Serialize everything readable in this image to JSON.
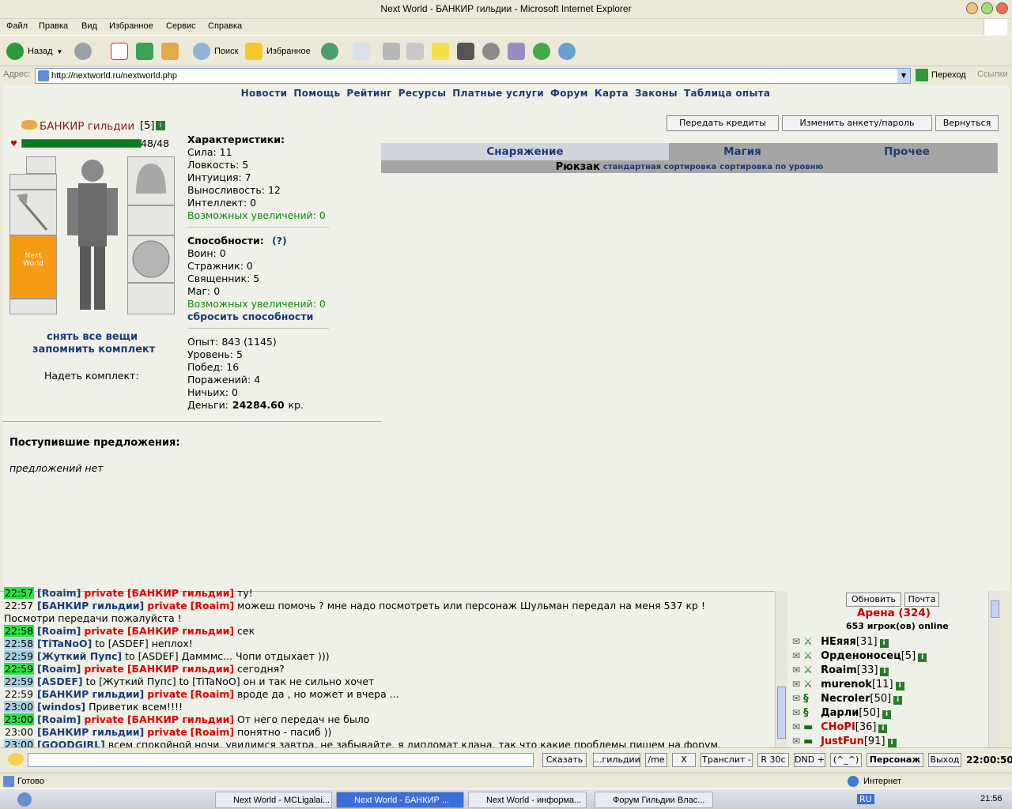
{
  "window": {
    "title": "Next World - БАНКИР гильдии - Microsoft Internet Explorer"
  },
  "menu": [
    "Файл",
    "Правка",
    "Вид",
    "Избранное",
    "Сервис",
    "Справка"
  ],
  "toolbar": {
    "back": "Назад",
    "search": "Поиск",
    "favorites": "Избранное"
  },
  "address": {
    "label": "Адрес:",
    "url": "http://nextworld.ru/nextworld.php",
    "go": "Переход",
    "links": "Ссылки"
  },
  "nav": [
    "Новости",
    "Помощь",
    "Рейтинг",
    "Ресурсы",
    "Платные услуги",
    "Форум",
    "Карта",
    "Законы",
    "Таблица опыта"
  ],
  "char": {
    "name": "БАНКИР гильдии",
    "level": "[5]",
    "hp": "48/48",
    "hp_fraction": 1.0,
    "shirt_text": "Next World"
  },
  "char_links": {
    "unequip": "снять все вещи",
    "remember": "запомнить комплект",
    "wear": "Надеть комплект:"
  },
  "stats": {
    "header": "Характеристики:",
    "lines": [
      "Сила: 11",
      "Ловкость: 5",
      "Интуиция: 7",
      "Выносливость: 12",
      "Интеллект: 0"
    ],
    "increases": "Возможных увеличений: 0"
  },
  "abilities": {
    "header": "Способности:",
    "help": "(?)",
    "lines": [
      "Воин: 0",
      "Стражник: 0",
      "Священник: 5",
      "Маг: 0"
    ],
    "increases": "Возможных увеличений: 0",
    "reset": "сбросить способности"
  },
  "progress": {
    "lines": [
      "Опыт: 843 (1145)",
      "Уровень: 5",
      "Побед: 16",
      "Поражений: 4",
      "Ничьих: 0"
    ],
    "money_label": "Деньги:",
    "money_value": "24284.60",
    "money_unit": "кр."
  },
  "offers": {
    "title": "Поступившие предложения:",
    "empty": "предложений нет"
  },
  "actions": {
    "transfer": "Передать кредиты",
    "edit": "Изменить анкету/пароль",
    "back": "Вернуться"
  },
  "inv_tabs": [
    "Снаряжение",
    "Магия",
    "Прочее"
  ],
  "backpack": {
    "label": "Рюкзак",
    "sort_std": "стандартная сортировка",
    "sort_lvl": "сортировка по уровню"
  },
  "chat": {
    "lines": [
      {
        "ts": "22:57",
        "tsStyle": "g",
        "n1": "[Roaim]",
        "priv": "private",
        "n2": "[БАНКИР гильдии]",
        "text": " ту!"
      },
      {
        "ts": "22:57",
        "tsStyle": "",
        "n1": "[БАНКИР гильдии]",
        "priv": "private",
        "n2": "[Roaim]",
        "text": " можеш помочь ? мне надо посмотреть или персонаж Шульман передал на меня 537 кр !"
      },
      {
        "ts": "",
        "tsStyle": "",
        "n1": "",
        "priv": "",
        "n2": "",
        "text": "Посмотри передачи пожалуйста !"
      },
      {
        "ts": "22:58",
        "tsStyle": "g",
        "n1": "[Roaim]",
        "priv": "private",
        "n2": "[БАНКИР гильдии]",
        "text": " сек"
      },
      {
        "ts": "22:58",
        "tsStyle": "b",
        "n1": "[TiTaNoO]",
        "priv": "",
        "n2": "",
        "text": " to [ASDEF] неплох!"
      },
      {
        "ts": "22:59",
        "tsStyle": "b",
        "n1": "[Жуткий Пупс]",
        "priv": "",
        "n2": "",
        "text": " to [ASDEF] Дамммс... Чопи отдыхает )))"
      },
      {
        "ts": "22:59",
        "tsStyle": "g",
        "n1": "[Roaim]",
        "priv": "private",
        "n2": "[БАНКИР гильдии]",
        "text": " сегодня?"
      },
      {
        "ts": "22:59",
        "tsStyle": "b",
        "n1": "[ASDEF]",
        "priv": "",
        "n2": "",
        "text": " to [Жуткий Пупс] to [TiTaNoO] он и так не сильно хочет"
      },
      {
        "ts": "22:59",
        "tsStyle": "",
        "n1": "[БАНКИР гильдии]",
        "priv": "private",
        "n2": "[Roaim]",
        "text": " вроде да , но может и вчера ..."
      },
      {
        "ts": "23:00",
        "tsStyle": "b",
        "n1": "[windos]",
        "priv": "",
        "n2": "",
        "text": " Приветик всем!!!!"
      },
      {
        "ts": "23:00",
        "tsStyle": "g",
        "n1": "[Roaim]",
        "priv": "private",
        "n2": "[БАНКИР гильдии]",
        "text": " От него передач не было"
      },
      {
        "ts": "23:00",
        "tsStyle": "",
        "n1": "[БАНКИР гильдии]",
        "priv": "private",
        "n2": "[Roaim]",
        "text": " понятно - пасиб ))"
      },
      {
        "ts": "23:00",
        "tsStyle": "b",
        "n1": "[GOODGIRL]",
        "priv": "",
        "n2": "",
        "text": " всем спокойной ночи, увидимся завтра, не забывайте, я дипломат клана, так что какие проблемы пишем на форум,"
      }
    ]
  },
  "users": {
    "refresh": "Обновить",
    "mail": "Почта",
    "arena": "Арена (324)",
    "online": "653 игрок(ов) online",
    "list": [
      {
        "name": "НЕяяя",
        "lvl": "[31]",
        "color": "#000000",
        "sym": "⚔"
      },
      {
        "name": "Орденоносец",
        "lvl": "[5]",
        "color": "#000000",
        "sym": "⚔"
      },
      {
        "name": "Roaim",
        "lvl": "[33]",
        "color": "#000000",
        "sym": "⚔"
      },
      {
        "name": "murenok",
        "lvl": "[11]",
        "color": "#000000",
        "sym": "⚔"
      },
      {
        "name": "Necroler",
        "lvl": "[50]",
        "color": "#000000",
        "sym": "§"
      },
      {
        "name": "Дарли",
        "lvl": "[50]",
        "color": "#000000",
        "sym": "§"
      },
      {
        "name": "CHoPI",
        "lvl": "[36]",
        "color": "#c00000",
        "sym": "▬"
      },
      {
        "name": "JustFun",
        "lvl": "[91]",
        "color": "#c00000",
        "sym": "▬"
      }
    ]
  },
  "input": {
    "say": "Сказать",
    "guild": "...гильдии",
    "me": "/me",
    "x": "X",
    "translit": "Транслит -",
    "r30": "R 30с",
    "dnd": "DND +",
    "smile": "(^_^)",
    "person": "Персонаж",
    "exit": "Выход",
    "time": "22:00:50"
  },
  "status": {
    "ready": "Готово",
    "zone": "Интернет"
  },
  "taskbar": {
    "tasks": [
      "Next World - MCLigalai...",
      "Next World - БАНКИР ...",
      "Next World - информа...",
      "Форум Гильдии Влас..."
    ],
    "lang": "RU",
    "clock": "21:56"
  },
  "colors": {
    "navy": "#1b3a78",
    "hpbar": "#0b7a1f",
    "tabActive": "#cfd6dd",
    "tabInactive": "#a5a5a5",
    "shirt": "#f59b14"
  }
}
